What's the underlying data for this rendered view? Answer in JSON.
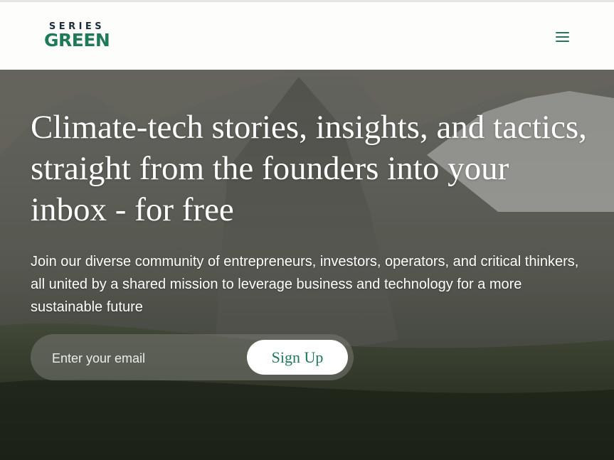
{
  "header": {
    "logo": {
      "top": "SERIES",
      "bottom": "GREEN"
    },
    "menu_icon": "hamburger-menu-icon"
  },
  "hero": {
    "headline": "Climate-tech stories, insights, and tactics, straight from the founders into your inbox - for free",
    "subtext": "Join our diverse community of entrepreneurs, investors, operators, and critical thinkers, all united by a shared mission to leverage business and technology for a more sustainable future"
  },
  "signup": {
    "email_placeholder": "Enter your email",
    "button_label": "Sign Up"
  },
  "colors": {
    "brand_green": "#1f7a57",
    "logo_dark": "#1d2b3a"
  }
}
